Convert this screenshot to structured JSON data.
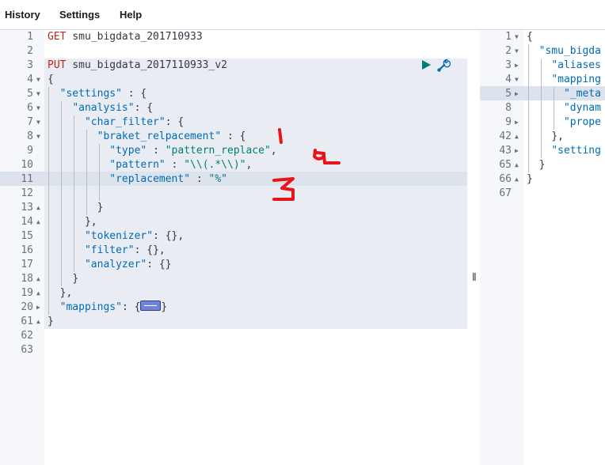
{
  "menu": {
    "history": "History",
    "settings": "Settings",
    "help": "Help"
  },
  "editor": {
    "line_numbers": [
      "1",
      "2",
      "3",
      "4",
      "5",
      "6",
      "7",
      "8",
      "9",
      "10",
      "11",
      "12",
      "13",
      "14",
      "15",
      "16",
      "17",
      "18",
      "19",
      "20",
      "61",
      "62",
      "63"
    ],
    "lines": {
      "l1_method": "GET",
      "l1_index": "smu_bigdata_201710933",
      "l3_method": "PUT",
      "l3_index": "smu_bigdata_2017110933_v2",
      "l4": "{",
      "l5_key": "\"settings\"",
      "l5_rest": " : {",
      "l6_key": "\"analysis\"",
      "l6_rest": ": {",
      "l7_key": "\"char_filter\"",
      "l7_rest": ": {",
      "l8_key": "\"braket_relpacement\"",
      "l8_rest": " : {",
      "l9_key": "\"type\"",
      "l9_mid": " : ",
      "l9_val": "\"pattern_replace\"",
      "l9_end": ",",
      "l10_key": "\"pattern\"",
      "l10_mid": " : ",
      "l10_val": "\"\\\\(.*\\\\)\"",
      "l10_end": ",",
      "l11_key": "\"replacement\"",
      "l11_mid": " : ",
      "l11_val": "\"%\"",
      "l13": "}",
      "l14": "},",
      "l15_key": "\"tokenizer\"",
      "l15_rest": ": {},",
      "l16_key": "\"filter\"",
      "l16_rest": ": {},",
      "l17_key": "\"analyzer\"",
      "l17_rest": ": {}",
      "l18": "}",
      "l19": "},",
      "l20_key": "\"mappings\"",
      "l20_rest": ": {",
      "l20_close": "}",
      "l61": "}"
    }
  },
  "output": {
    "line_numbers": [
      "1",
      "2",
      "3",
      "4",
      "5",
      "8",
      "9",
      "42",
      "43",
      "65",
      "66",
      "67"
    ],
    "lines": {
      "r1": "{",
      "r2": "\"smu_bigda",
      "r3": "\"aliases",
      "r4": "\"mapping",
      "r5": "\"_meta",
      "r8": "\"dynam",
      "r9": "\"prope",
      "r42": "},",
      "r43": "\"setting",
      "r65": "}",
      "r66": "}"
    }
  },
  "annotations": {
    "a1": "1",
    "a2": "2",
    "a3": "3",
    "color": "#e8141b"
  },
  "colors": {
    "method": "#bd271e",
    "key": "#006bb4",
    "string": "#017d73",
    "play": "#017d73",
    "wrench": "#006bb4"
  }
}
